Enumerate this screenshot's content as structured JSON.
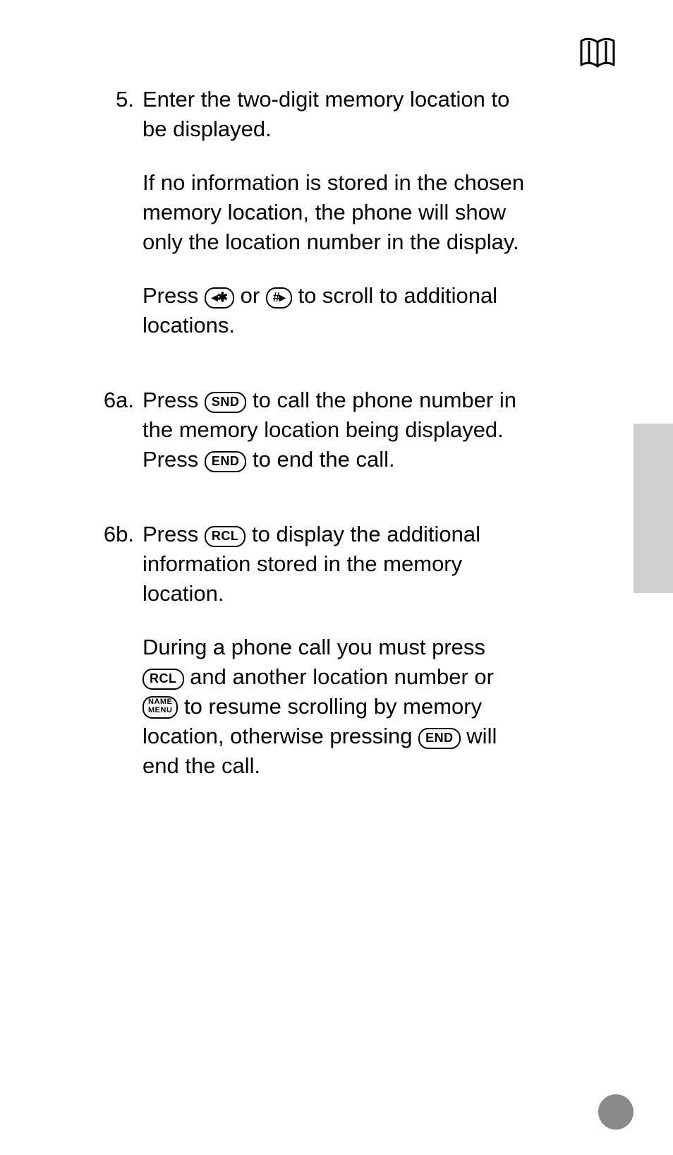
{
  "steps": {
    "n5": {
      "num": "5.",
      "p1": "Enter the two-digit memory location to be displayed.",
      "p2": "If no information is stored in the chosen memory location, the phone will show only the location number in the display.",
      "p3a": "Press ",
      "keyLeft": "◂✱",
      "p3b": " or ",
      "keyRight": "#▸",
      "p3c": " to scroll to additional locations."
    },
    "n6a": {
      "num": "6a.",
      "p1a": "Press ",
      "keySnd": "SND",
      "p1b": " to call the phone number in the memory location being displayed. Press ",
      "keyEnd": "END",
      "p1c": " to end the call."
    },
    "n6b": {
      "num": "6b.",
      "p1a": "Press ",
      "keyRcl1": "RCL",
      "p1b": " to display the additional information stored in the memory location.",
      "p2a": "During a phone call you must press ",
      "keyRcl2": "RCL",
      "p2b": " and another location number or ",
      "keyName1": "NAME",
      "keyName2": "MENU",
      "p2c": " to resume scrolling by memory location, otherwise pressing ",
      "keyEnd2": "END",
      "p2d": " will end the call."
    }
  }
}
